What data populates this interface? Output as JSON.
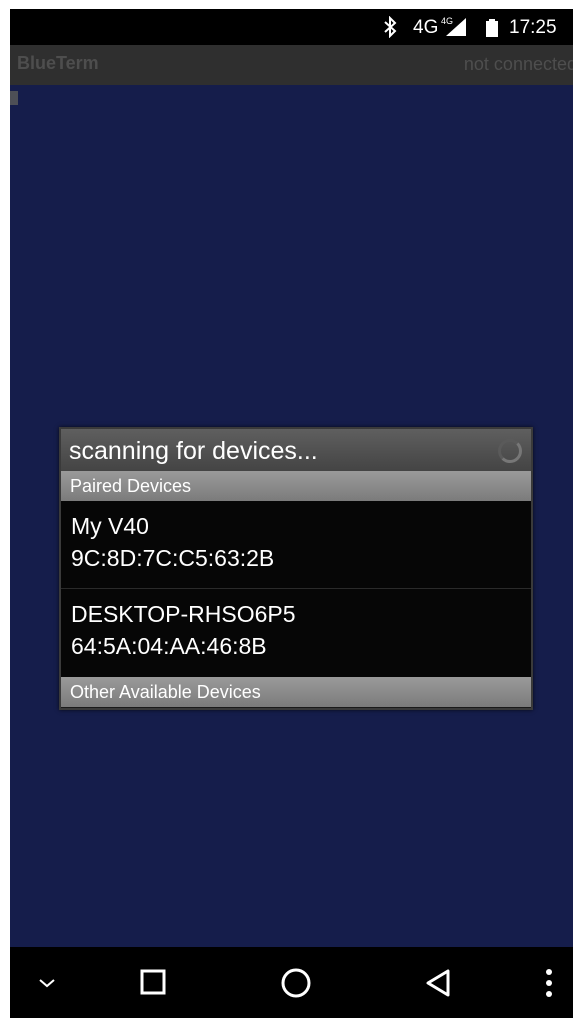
{
  "status_bar": {
    "bluetooth_icon": "bluetooth-icon",
    "network": "4G",
    "network_sup": "4G",
    "signal_icon": "signal-icon",
    "battery_icon": "battery-icon",
    "time": "17:25"
  },
  "title_bar": {
    "app_name": "BlueTerm",
    "connection_status": "not connected"
  },
  "dialog": {
    "title": "scanning for devices...",
    "paired_header": "Paired Devices",
    "devices": [
      {
        "name": "My V40",
        "address": "9C:8D:7C:C5:63:2B"
      },
      {
        "name": "DESKTOP-RHSO6P5",
        "address": "64:5A:04:AA:46:8B"
      }
    ],
    "other_header": "Other Available Devices"
  },
  "nav_bar": {
    "items": [
      "chevron-down-icon",
      "square-icon",
      "circle-icon",
      "triangle-back-icon",
      "more-vert-icon"
    ]
  },
  "colors": {
    "terminal_bg": "#151d4b",
    "title_bar_bg": "#2f2f2f",
    "dialog_bg": "#060606",
    "section_header_bg": "#8a8a8a"
  }
}
